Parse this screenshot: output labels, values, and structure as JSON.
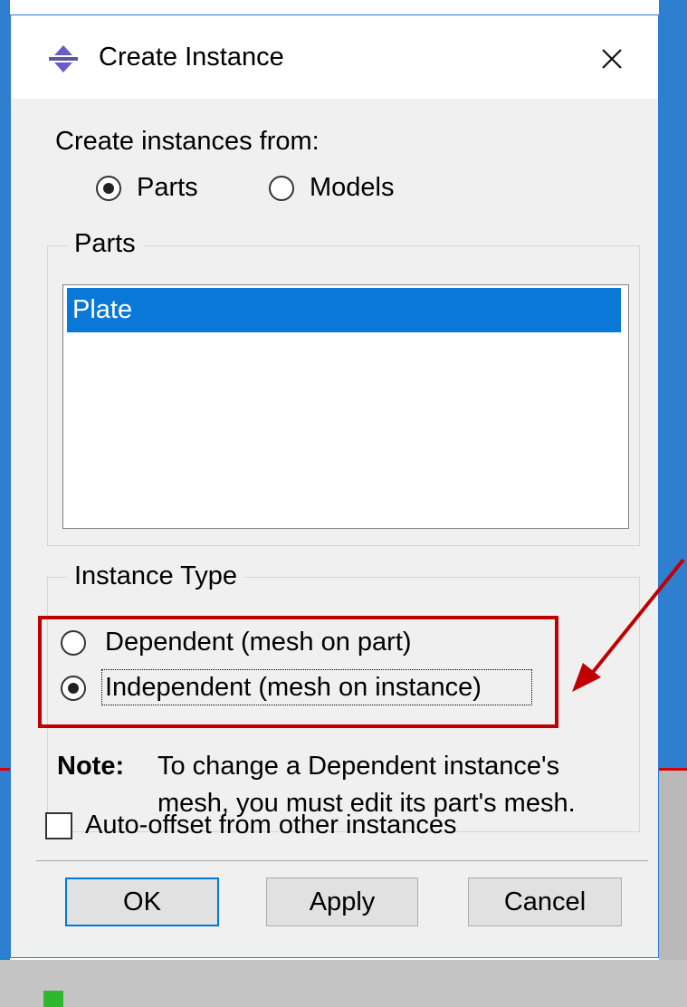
{
  "dialog": {
    "title": "Create Instance",
    "create_from_label": "Create instances from:",
    "source_options": [
      {
        "label": "Parts",
        "checked": true
      },
      {
        "label": "Models",
        "checked": false
      }
    ],
    "parts_group_title": "Parts",
    "parts_list": [
      {
        "label": "Plate",
        "selected": true
      }
    ],
    "instance_type_group_title": "Instance Type",
    "instance_type_options": [
      {
        "label": "Dependent (mesh on part)",
        "checked": false
      },
      {
        "label": "Independent (mesh on instance)",
        "checked": true
      }
    ],
    "note_label": "Note:",
    "note_line1": "To change a Dependent instance's",
    "note_line2": "mesh, you must edit its part's mesh.",
    "auto_offset_label": "Auto-offset from other instances",
    "auto_offset_checked": false,
    "buttons": {
      "ok": "OK",
      "apply": "Apply",
      "cancel": "Cancel"
    }
  },
  "colors": {
    "selection": "#0a78d7",
    "annotation": "#c00000",
    "window_border": "#2d7bd4"
  },
  "icons": [
    "app-icon",
    "close-icon"
  ]
}
